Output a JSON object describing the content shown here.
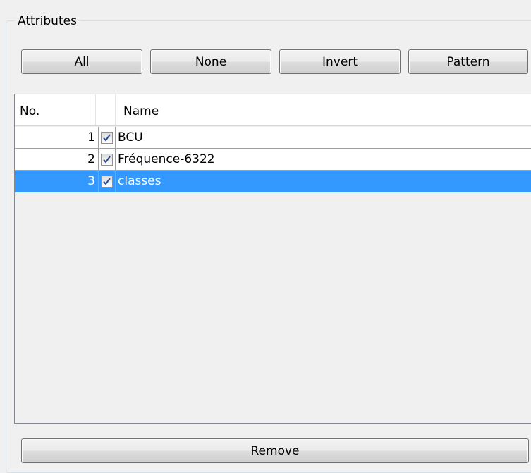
{
  "group": {
    "title": "Attributes"
  },
  "buttons": {
    "all": "All",
    "none": "None",
    "invert": "Invert",
    "pattern": "Pattern",
    "remove": "Remove"
  },
  "table": {
    "columns": [
      "No.",
      "",
      "Name"
    ],
    "rows": [
      {
        "no": "1",
        "checked": true,
        "name": "BCU",
        "selected": false
      },
      {
        "no": "2",
        "checked": true,
        "name": "Fréquence-6322",
        "selected": false
      },
      {
        "no": "3",
        "checked": true,
        "name": "classes",
        "selected": true
      }
    ]
  },
  "colors": {
    "selection": "#3399ff",
    "checkmark": "#2a4a8f"
  }
}
